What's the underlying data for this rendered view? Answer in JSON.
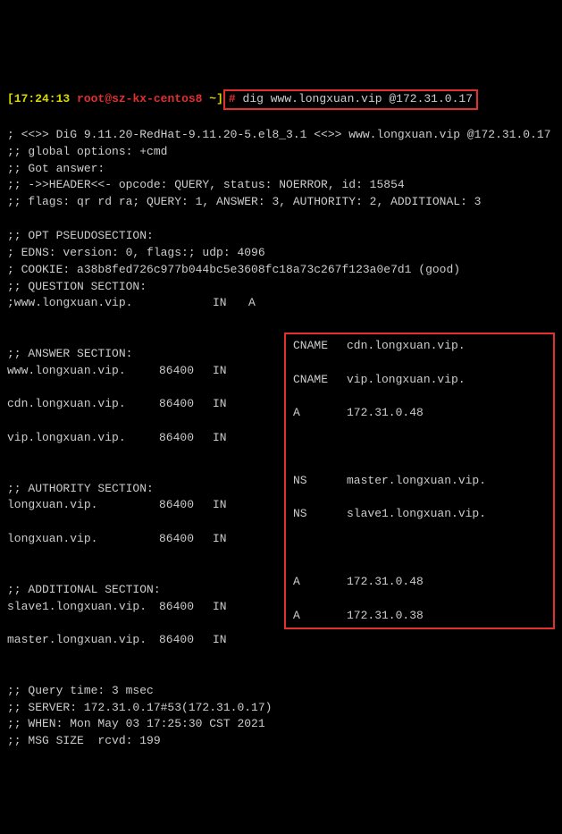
{
  "prompt": {
    "timestamp": "[17:24:13",
    "user": "root",
    "host": "sz-kx-centos8",
    "path": "~",
    "command": "dig www.longxuan.vip @172.31.0.17"
  },
  "output": {
    "banner": "; <<>> DiG 9.11.20-RedHat-9.11.20-5.el8_3.1 <<>> www.longxuan.vip @172.31.0.17",
    "global_opts": ";; global options: +cmd",
    "got_answer": ";; Got answer:",
    "header": ";; ->>HEADER<<- opcode: QUERY, status: NOERROR, id: 15854",
    "flags": ";; flags: qr rd ra; QUERY: 1, ANSWER: 3, AUTHORITY: 2, ADDITIONAL: 3",
    "opt_hdr": ";; OPT PSEUDOSECTION:",
    "edns": "; EDNS: version: 0, flags:; udp: 4096",
    "cookie": "; COOKIE: a38b8fed726c977b044bc5e3608fc18a73c267f123a0e7d1 (good)",
    "question_hdr": ";; QUESTION SECTION:",
    "question_name": ";www.longxuan.vip.",
    "question_cls": "IN",
    "question_type": "A",
    "answer_hdr": ";; ANSWER SECTION:",
    "answers": [
      {
        "name": "www.longxuan.vip.",
        "ttl": "86400",
        "cls": "IN",
        "type": "CNAME",
        "val": "cdn.longxuan.vip."
      },
      {
        "name": "cdn.longxuan.vip.",
        "ttl": "86400",
        "cls": "IN",
        "type": "CNAME",
        "val": "vip.longxuan.vip."
      },
      {
        "name": "vip.longxuan.vip.",
        "ttl": "86400",
        "cls": "IN",
        "type": "A",
        "val": "172.31.0.48"
      }
    ],
    "authority_hdr": ";; AUTHORITY SECTION:",
    "authority": [
      {
        "name": "longxuan.vip.",
        "ttl": "86400",
        "cls": "IN",
        "type": "NS",
        "val": "master.longxuan.vip."
      },
      {
        "name": "longxuan.vip.",
        "ttl": "86400",
        "cls": "IN",
        "type": "NS",
        "val": "slave1.longxuan.vip."
      }
    ],
    "additional_hdr": ";; ADDITIONAL SECTION:",
    "additional": [
      {
        "name": "slave1.longxuan.vip.",
        "ttl": "86400",
        "cls": "IN",
        "type": "A",
        "val": "172.31.0.48"
      },
      {
        "name": "master.longxuan.vip.",
        "ttl": "86400",
        "cls": "IN",
        "type": "A",
        "val": "172.31.0.38"
      }
    ],
    "query_time": ";; Query time: 3 msec",
    "server": ";; SERVER: 172.31.0.17#53(172.31.0.17)",
    "when": ";; WHEN: Mon May 03 17:25:30 CST 2021",
    "msg_size": ";; MSG SIZE  rcvd: 199"
  }
}
